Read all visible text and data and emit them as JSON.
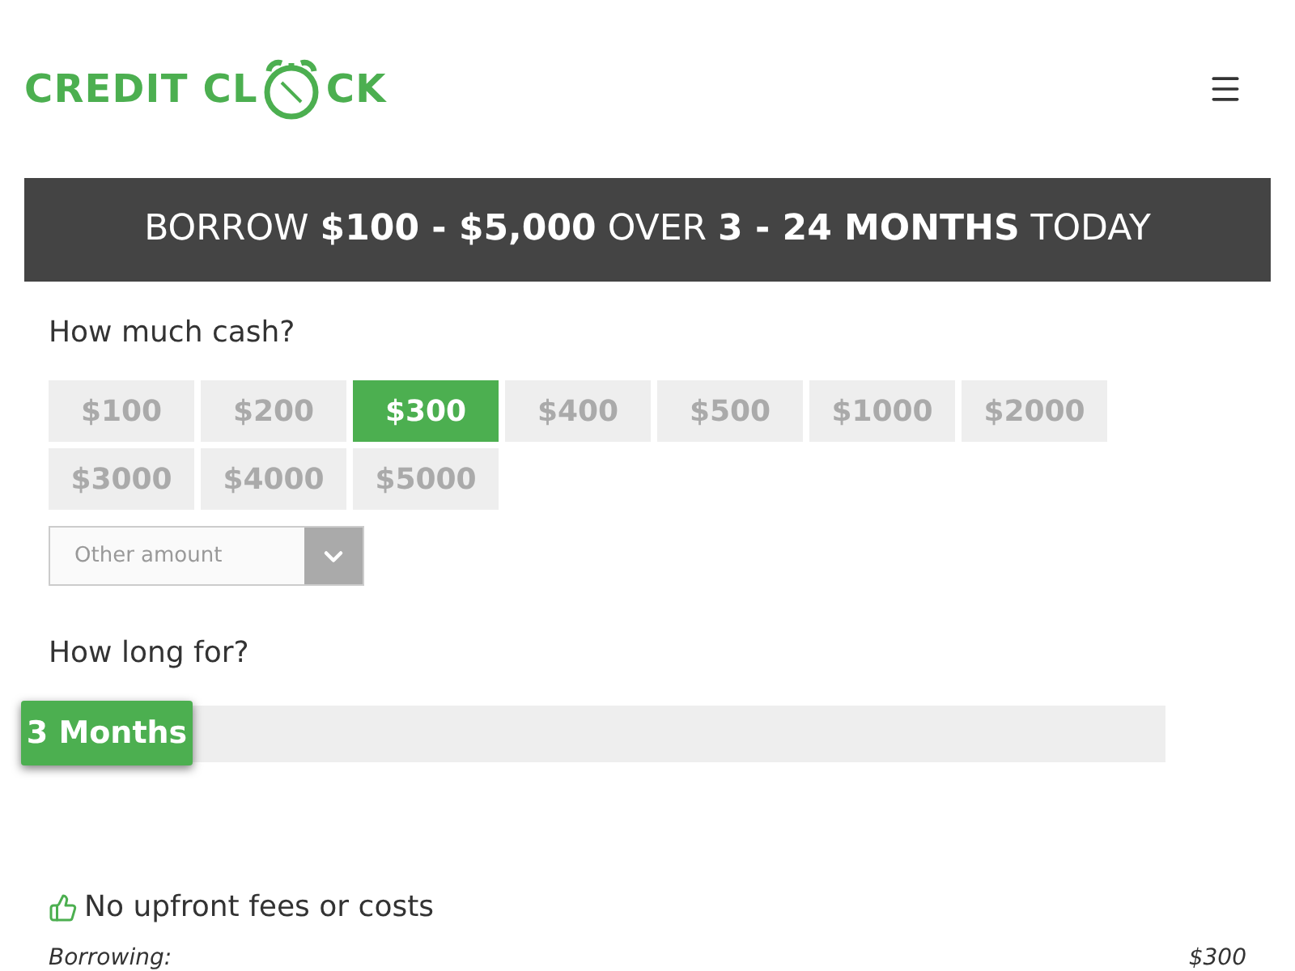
{
  "logo": {
    "left": "CREDIT CL",
    "right": "CK"
  },
  "banner": "BORROW **$100 - $5,000** OVER **3 - 24 MONTHS** TODAY",
  "amount": {
    "heading": "How much cash?",
    "options": [
      {
        "label": "$100",
        "selected": false
      },
      {
        "label": "$200",
        "selected": false
      },
      {
        "label": "$300",
        "selected": true
      },
      {
        "label": "$400",
        "selected": false
      },
      {
        "label": "$500",
        "selected": false
      },
      {
        "label": "$1000",
        "selected": false
      },
      {
        "label": "$2000",
        "selected": false
      },
      {
        "label": "$3000",
        "selected": false
      },
      {
        "label": "$4000",
        "selected": false
      },
      {
        "label": "$5000",
        "selected": false
      }
    ],
    "other": {
      "placeholder": "Other amount"
    }
  },
  "term": {
    "heading": "How long for?",
    "slider": {
      "label": "3 Months",
      "level": 0
    }
  },
  "feature": "No upfront fees or costs",
  "summary": {
    "label": "Borrowing:",
    "value": "$300"
  }
}
